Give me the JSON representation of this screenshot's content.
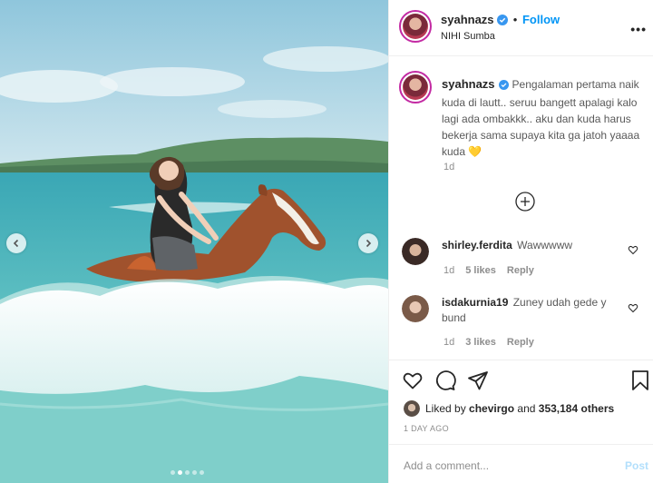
{
  "post": {
    "username": "syahnazs",
    "follow_label": "Follow",
    "separator": "•",
    "location": "NIHI Sumba",
    "caption": "Pengalaman pertama naik kuda di lautt.. seruu bangett apalagi kalo lagi ada ombakkk.. aku dan kuda harus bekerja sama supaya kita ga jatoh yaaaa kuda 💛",
    "caption_age": "1d",
    "more_label": "•••"
  },
  "comments": [
    {
      "username": "shirley.ferdita",
      "text": "Wawwwww",
      "age": "1d",
      "likes": "5 likes",
      "reply": "Reply"
    },
    {
      "username": "isdakurnia19",
      "text": "Zuney udah gede y bund",
      "age": "1d",
      "likes": "3 likes",
      "reply": "Reply"
    }
  ],
  "likes": {
    "prefix": "Liked by",
    "user": "chevirgo",
    "and": "and",
    "count": "353,184 others"
  },
  "timestamp": "1 DAY AGO",
  "composer": {
    "placeholder": "Add a comment...",
    "post_label": "Post"
  },
  "carousel": {
    "total": 5,
    "active": 1
  },
  "icons": {
    "verified": "verified-badge-icon",
    "like": "heart-icon",
    "comment": "comment-icon",
    "share": "send-icon",
    "save": "bookmark-icon",
    "add": "plus-circle-icon"
  },
  "colors": {
    "accent": "#0095f6",
    "verified": "#3897f0",
    "text": "#262626",
    "muted": "#8e8e8e"
  }
}
